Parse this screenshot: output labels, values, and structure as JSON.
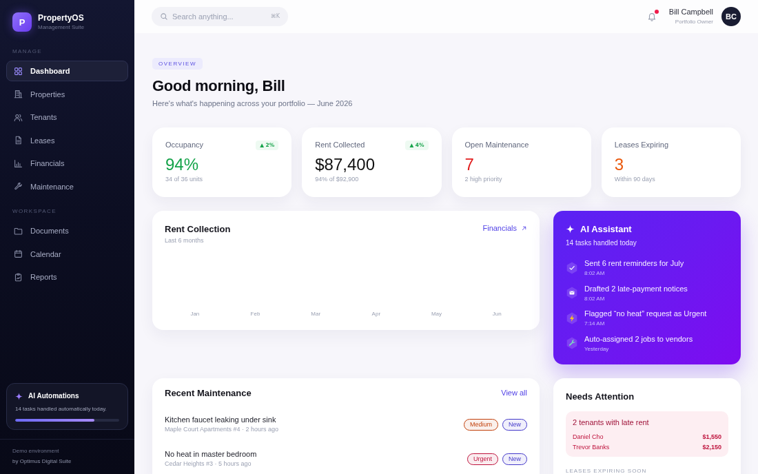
{
  "sidebar": {
    "brand": {
      "logo": "P",
      "name": "PropertyOS",
      "tagline": "Management Suite"
    },
    "sections": [
      {
        "heading": "MANAGE",
        "items": [
          {
            "label": "Dashboard",
            "selected": true
          },
          {
            "label": "Properties",
            "selected": false
          },
          {
            "label": "Tenants",
            "selected": false
          },
          {
            "label": "Leases",
            "selected": false
          },
          {
            "label": "Financials",
            "selected": false
          },
          {
            "label": "Maintenance",
            "selected": false
          }
        ]
      },
      {
        "heading": "WORKSPACE",
        "items": [
          {
            "label": "Documents",
            "selected": false
          },
          {
            "label": "Calendar",
            "selected": false
          },
          {
            "label": "Reports",
            "selected": false
          }
        ]
      }
    ],
    "automation_card": {
      "title": "AI Automations",
      "text": "14 tasks handled automatically today.",
      "level": 0.76
    },
    "footer": [
      "Demo environment",
      "by Optimus Digital Suite"
    ]
  },
  "topbar": {
    "search": {
      "placeholder": "Search anything...",
      "shortcut": "⌘K"
    },
    "notifications": {
      "unread": true
    },
    "user": {
      "name": "Bill Campbell",
      "role": "Portfolio Owner",
      "initials": "BC"
    }
  },
  "header": {
    "eyebrow": "OVERVIEW",
    "title": "Good morning, Bill",
    "subtitle": "Here's what's happening across your portfolio — June 2026"
  },
  "stats": [
    {
      "label": "Occupancy",
      "delta": "▲ 2%",
      "value": "94%",
      "color": "#16a34a",
      "note": "34 of 36 units"
    },
    {
      "label": "Rent Collected",
      "delta": "▲ 4%",
      "value": "$87,400",
      "color": "#111111",
      "note": "94% of $92,900"
    },
    {
      "label": "Open Maintenance",
      "value": "7",
      "color": "#e11d1d",
      "note": "2 high priority"
    },
    {
      "label": "Leases Expiring",
      "value": "3",
      "color": "#ea580c",
      "note": "Within 90 days"
    }
  ],
  "rent_collection": {
    "title": "Rent Collection",
    "subtitle": "Last 6 months",
    "link": "Financials",
    "months": [
      "Jan",
      "Feb",
      "Mar",
      "Apr",
      "May",
      "Jun"
    ]
  },
  "ai_assistant": {
    "title": "AI Assistant",
    "subtitle": "14 tasks handled today",
    "activity": [
      {
        "text": "Sent 6 rent reminders for July",
        "time": "8:02 AM"
      },
      {
        "text": "Drafted 2 late-payment notices",
        "time": "8:02 AM"
      },
      {
        "text": "Flagged “no heat” request as Urgent",
        "time": "7:14 AM"
      },
      {
        "text": "Auto-assigned 2 jobs to vendors",
        "time": "Yesterday"
      }
    ]
  },
  "recent_maintenance": {
    "title": "Recent Maintenance",
    "link": "View all",
    "requests": [
      {
        "title": "Kitchen faucet leaking under sink",
        "meta": "Maple Court Apartments #4 · 2 hours ago",
        "tags": [
          {
            "label": "Medium",
            "color": "#c2410c"
          },
          {
            "label": "New",
            "color": "#4338ca"
          }
        ]
      },
      {
        "title": "No heat in master bedroom",
        "meta": "Cedar Heights #3 · 5 hours ago",
        "tags": [
          {
            "label": "Urgent",
            "color": "#be123c"
          },
          {
            "label": "New",
            "color": "#4338ca"
          }
        ]
      }
    ]
  },
  "needs_attention": {
    "title": "Needs Attention",
    "late_rent": {
      "title": "2 tenants with late rent",
      "tenants": [
        {
          "name": "Daniel Cho",
          "amount": "$1,550"
        },
        {
          "name": "Trevor Banks",
          "amount": "$2,150"
        }
      ]
    },
    "leases_heading": "LEASES EXPIRING SOON"
  }
}
